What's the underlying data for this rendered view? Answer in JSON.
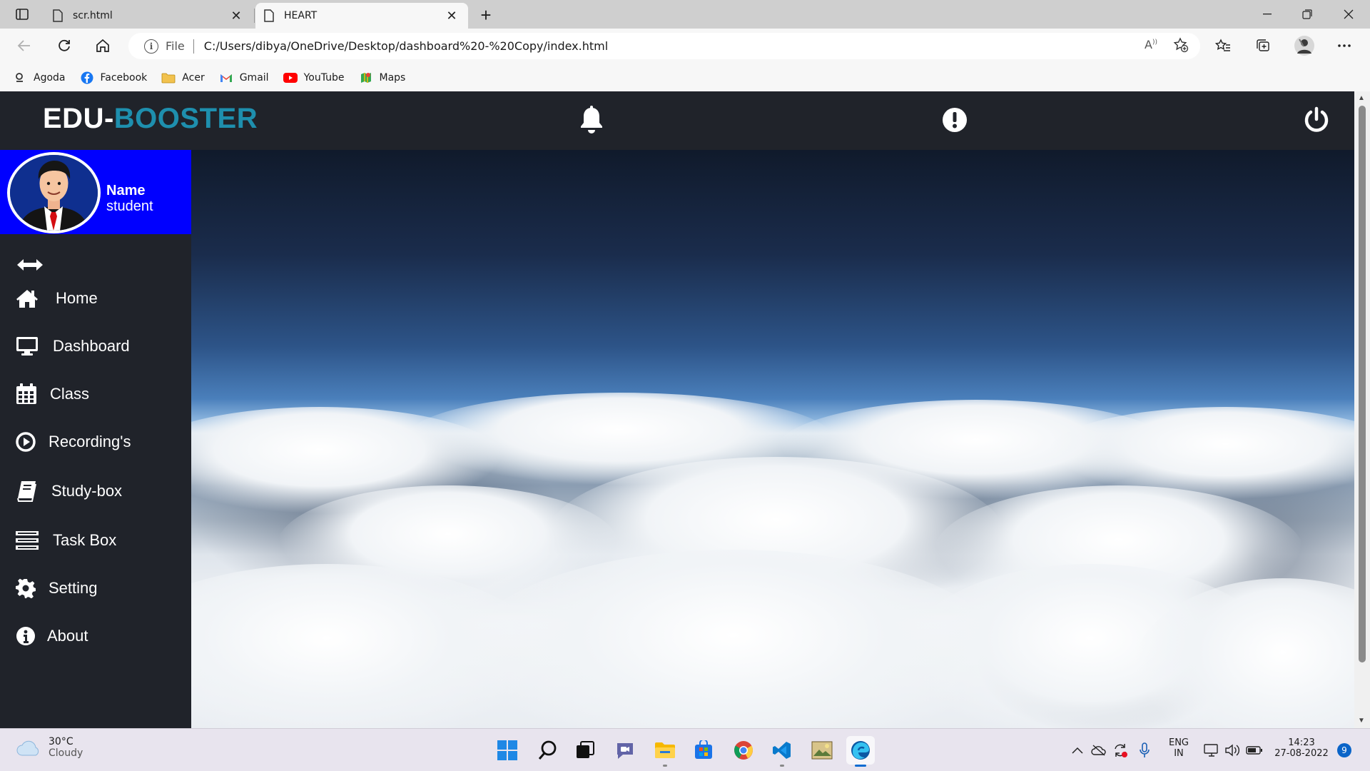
{
  "browser": {
    "tabs": [
      {
        "title": "scr.html",
        "active": false
      },
      {
        "title": "HEART",
        "active": true
      }
    ],
    "address": {
      "scheme": "File",
      "url": "C:/Users/dibya/OneDrive/Desktop/dashboard%20-%20Copy/index.html"
    },
    "bookmarks": [
      {
        "label": "Agoda",
        "icon": "agoda-icon"
      },
      {
        "label": "Facebook",
        "icon": "facebook-icon"
      },
      {
        "label": "Acer",
        "icon": "folder-icon"
      },
      {
        "label": "Gmail",
        "icon": "gmail-icon"
      },
      {
        "label": "YouTube",
        "icon": "youtube-icon"
      },
      {
        "label": "Maps",
        "icon": "maps-icon"
      }
    ]
  },
  "app": {
    "brand_part1": "EDU-",
    "brand_part2": "BOOSTER",
    "header_icons": [
      "bell-icon",
      "alert-icon",
      "power-icon"
    ],
    "profile": {
      "name": "Name",
      "role": "student"
    },
    "nav": [
      {
        "label": "Home",
        "icon": "home-icon"
      },
      {
        "label": "Dashboard",
        "icon": "monitor-icon"
      },
      {
        "label": "Class",
        "icon": "calendar-icon"
      },
      {
        "label": "Recording's",
        "icon": "play-circle-icon"
      },
      {
        "label": "Study-box",
        "icon": "book-icon"
      },
      {
        "label": "Task Box",
        "icon": "list-icon"
      },
      {
        "label": "Setting",
        "icon": "gear-icon"
      },
      {
        "label": "About",
        "icon": "info-icon"
      }
    ],
    "colors": {
      "header_bg": "#20232a",
      "brand_accent": "#1e8fae",
      "profile_bg": "#0000ff"
    }
  },
  "taskbar": {
    "weather": {
      "temp": "30°C",
      "condition": "Cloudy"
    },
    "language": {
      "line1": "ENG",
      "line2": "IN"
    },
    "clock": {
      "time": "14:23",
      "date": "27-08-2022"
    },
    "notifications": "9"
  }
}
